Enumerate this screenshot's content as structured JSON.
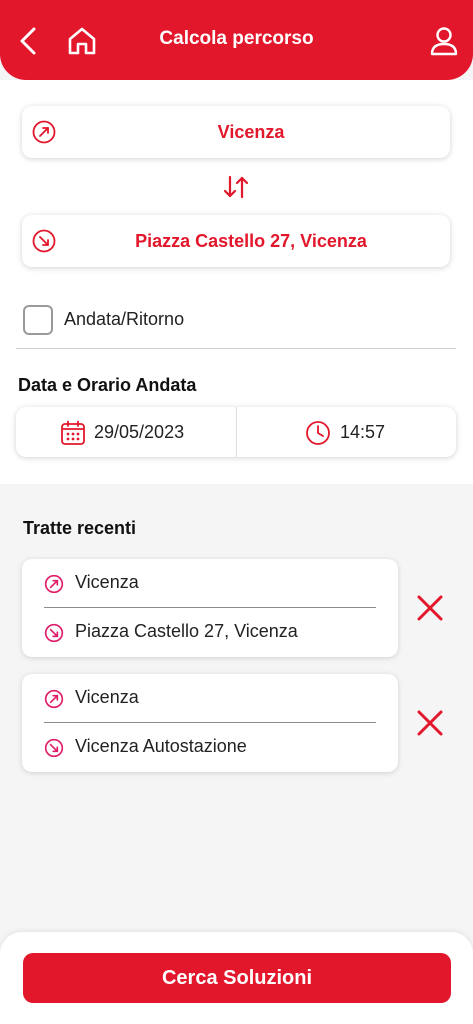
{
  "header": {
    "title": "Calcola percorso",
    "icons": [
      "chevron-left-icon",
      "home-icon",
      "user-icon"
    ]
  },
  "route": {
    "origin": "Vicenza",
    "destination": "Piazza Castello 27, Vicenza"
  },
  "roundtrip": {
    "label": "Andata/Ritorno",
    "checked": false
  },
  "datetime": {
    "section_title": "Data e Orario Andata",
    "date": "29/05/2023",
    "time": "14:57"
  },
  "recent": {
    "title": "Tratte recenti",
    "items": [
      {
        "origin": "Vicenza",
        "destination": "Piazza Castello 27, Vicenza"
      },
      {
        "origin": "Vicenza",
        "destination": "Vicenza Autostazione"
      }
    ]
  },
  "cta": {
    "label": "Cerca Soluzioni"
  },
  "colors": {
    "accent": "#e3172b",
    "background": "#f5f5f5"
  }
}
